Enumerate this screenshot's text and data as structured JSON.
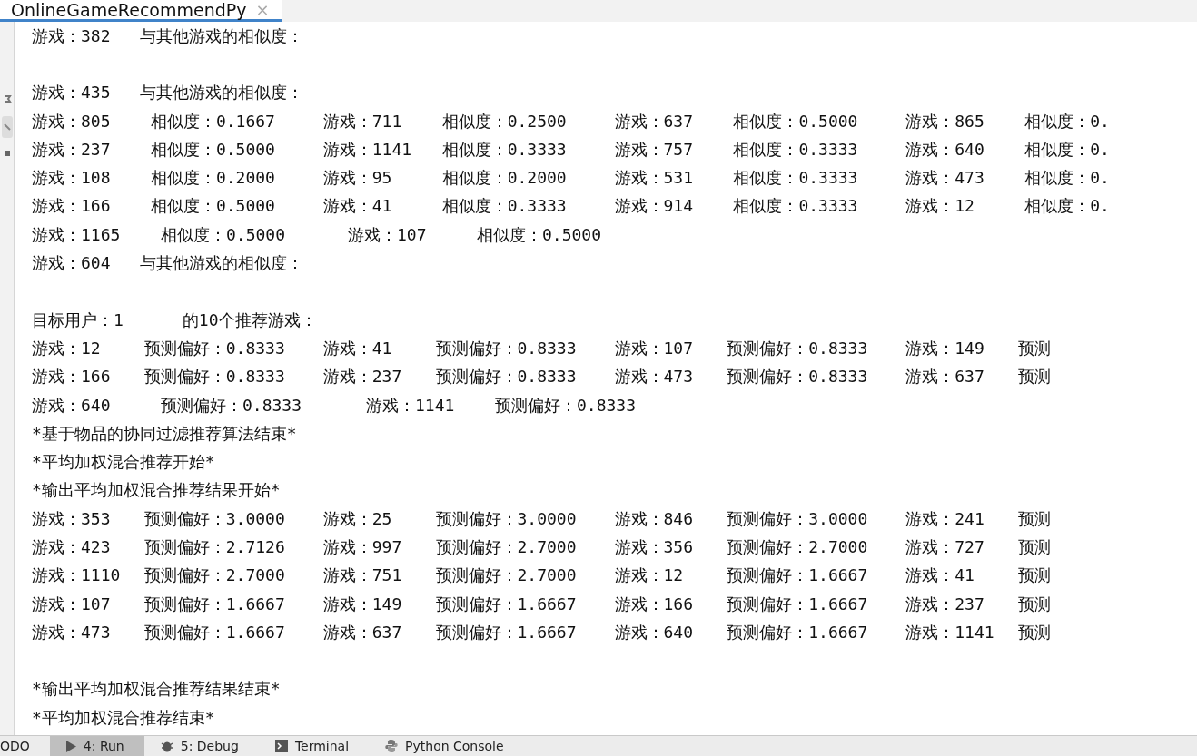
{
  "editor_tab": {
    "title": "OnlineGameRecommendPy",
    "close": "×",
    "selected": true
  },
  "console_lines": [
    {
      "kind": "text",
      "text": "游戏：382   与其他游戏的相似度："
    },
    {
      "kind": "blank"
    },
    {
      "kind": "text",
      "text": "游戏：435   与其他游戏的相似度："
    },
    {
      "kind": "similarity",
      "pairs": [
        {
          "game": "游戏：805",
          "value": "相似度：0.1667"
        },
        {
          "game": "游戏：711",
          "value": "相似度：0.2500"
        },
        {
          "game": "游戏：637",
          "value": "相似度：0.5000"
        },
        {
          "game": "游戏：865",
          "value": "相似度：0."
        }
      ]
    },
    {
      "kind": "similarity",
      "pairs": [
        {
          "game": "游戏：237",
          "value": "相似度：0.5000"
        },
        {
          "game": "游戏：1141",
          "value": "相似度：0.3333"
        },
        {
          "game": "游戏：757",
          "value": "相似度：0.3333"
        },
        {
          "game": "游戏：640",
          "value": "相似度：0."
        }
      ]
    },
    {
      "kind": "similarity",
      "pairs": [
        {
          "game": "游戏：108",
          "value": "相似度：0.2000"
        },
        {
          "game": "游戏：95",
          "value": "相似度：0.2000"
        },
        {
          "game": "游戏：531",
          "value": "相似度：0.3333"
        },
        {
          "game": "游戏：473",
          "value": "相似度：0."
        }
      ]
    },
    {
      "kind": "similarity",
      "pairs": [
        {
          "game": "游戏：166",
          "value": "相似度：0.5000"
        },
        {
          "game": "游戏：41",
          "value": "相似度：0.3333"
        },
        {
          "game": "游戏：914",
          "value": "相似度：0.3333"
        },
        {
          "game": "游戏：12",
          "value": "相似度：0."
        }
      ]
    },
    {
      "kind": "similarity",
      "pairs": [
        {
          "game": "游戏：1165",
          "value": "相似度：0.5000"
        },
        {
          "game": "游戏：107",
          "value": "相似度：0.5000"
        }
      ]
    },
    {
      "kind": "text",
      "text": "游戏：604   与其他游戏的相似度："
    },
    {
      "kind": "blank"
    },
    {
      "kind": "text",
      "text": "目标用户：1      的10个推荐游戏："
    },
    {
      "kind": "preference",
      "pairs": [
        {
          "game": "游戏：12",
          "value": "预测偏好：0.8333"
        },
        {
          "game": "游戏：41",
          "value": "预测偏好：0.8333"
        },
        {
          "game": "游戏：107",
          "value": "预测偏好：0.8333"
        },
        {
          "game": "游戏：149",
          "value": "预测"
        }
      ]
    },
    {
      "kind": "preference",
      "pairs": [
        {
          "game": "游戏：166",
          "value": "预测偏好：0.8333"
        },
        {
          "game": "游戏：237",
          "value": "预测偏好：0.8333"
        },
        {
          "game": "游戏：473",
          "value": "预测偏好：0.8333"
        },
        {
          "game": "游戏：637",
          "value": "预测"
        }
      ]
    },
    {
      "kind": "preference",
      "pairs": [
        {
          "game": "游戏：640",
          "value": "预测偏好：0.8333"
        },
        {
          "game": "游戏：1141",
          "value": "预测偏好：0.8333"
        }
      ]
    },
    {
      "kind": "text",
      "text": "*基于物品的协同过滤推荐算法结束*"
    },
    {
      "kind": "text",
      "text": "*平均加权混合推荐开始*"
    },
    {
      "kind": "text",
      "text": "*输出平均加权混合推荐结果开始*"
    },
    {
      "kind": "preference",
      "pairs": [
        {
          "game": "游戏：353",
          "value": "预测偏好：3.0000"
        },
        {
          "game": "游戏：25",
          "value": "预测偏好：3.0000"
        },
        {
          "game": "游戏：846",
          "value": "预测偏好：3.0000"
        },
        {
          "game": "游戏：241",
          "value": "预测"
        }
      ]
    },
    {
      "kind": "preference",
      "pairs": [
        {
          "game": "游戏：423",
          "value": "预测偏好：2.7126"
        },
        {
          "game": "游戏：997",
          "value": "预测偏好：2.7000"
        },
        {
          "game": "游戏：356",
          "value": "预测偏好：2.7000"
        },
        {
          "game": "游戏：727",
          "value": "预测"
        }
      ]
    },
    {
      "kind": "preference",
      "pairs": [
        {
          "game": "游戏：1110",
          "value": "预测偏好：2.7000"
        },
        {
          "game": "游戏：751",
          "value": "预测偏好：2.7000"
        },
        {
          "game": "游戏：12",
          "value": "预测偏好：1.6667"
        },
        {
          "game": "游戏：41",
          "value": "预测"
        }
      ]
    },
    {
      "kind": "preference",
      "pairs": [
        {
          "game": "游戏：107",
          "value": "预测偏好：1.6667"
        },
        {
          "game": "游戏：149",
          "value": "预测偏好：1.6667"
        },
        {
          "game": "游戏：166",
          "value": "预测偏好：1.6667"
        },
        {
          "game": "游戏：237",
          "value": "预测"
        }
      ]
    },
    {
      "kind": "preference",
      "pairs": [
        {
          "game": "游戏：473",
          "value": "预测偏好：1.6667"
        },
        {
          "game": "游戏：637",
          "value": "预测偏好：1.6667"
        },
        {
          "game": "游戏：640",
          "value": "预测偏好：1.6667"
        },
        {
          "game": "游戏：1141",
          "value": "预测"
        }
      ]
    },
    {
      "kind": "blank"
    },
    {
      "kind": "text",
      "text": "*输出平均加权混合推荐结果结束*"
    },
    {
      "kind": "text",
      "text": "*平均加权混合推荐结束*"
    }
  ],
  "tool_tabs": [
    {
      "kind": "plain",
      "label": "ODO",
      "selected": false
    },
    {
      "kind": "run",
      "label": "4: Run",
      "selected": true
    },
    {
      "kind": "debug",
      "label": "5: Debug",
      "selected": false
    },
    {
      "kind": "terminal",
      "label": "Terminal",
      "selected": false
    },
    {
      "kind": "python",
      "label": "Python Console",
      "selected": false
    }
  ]
}
